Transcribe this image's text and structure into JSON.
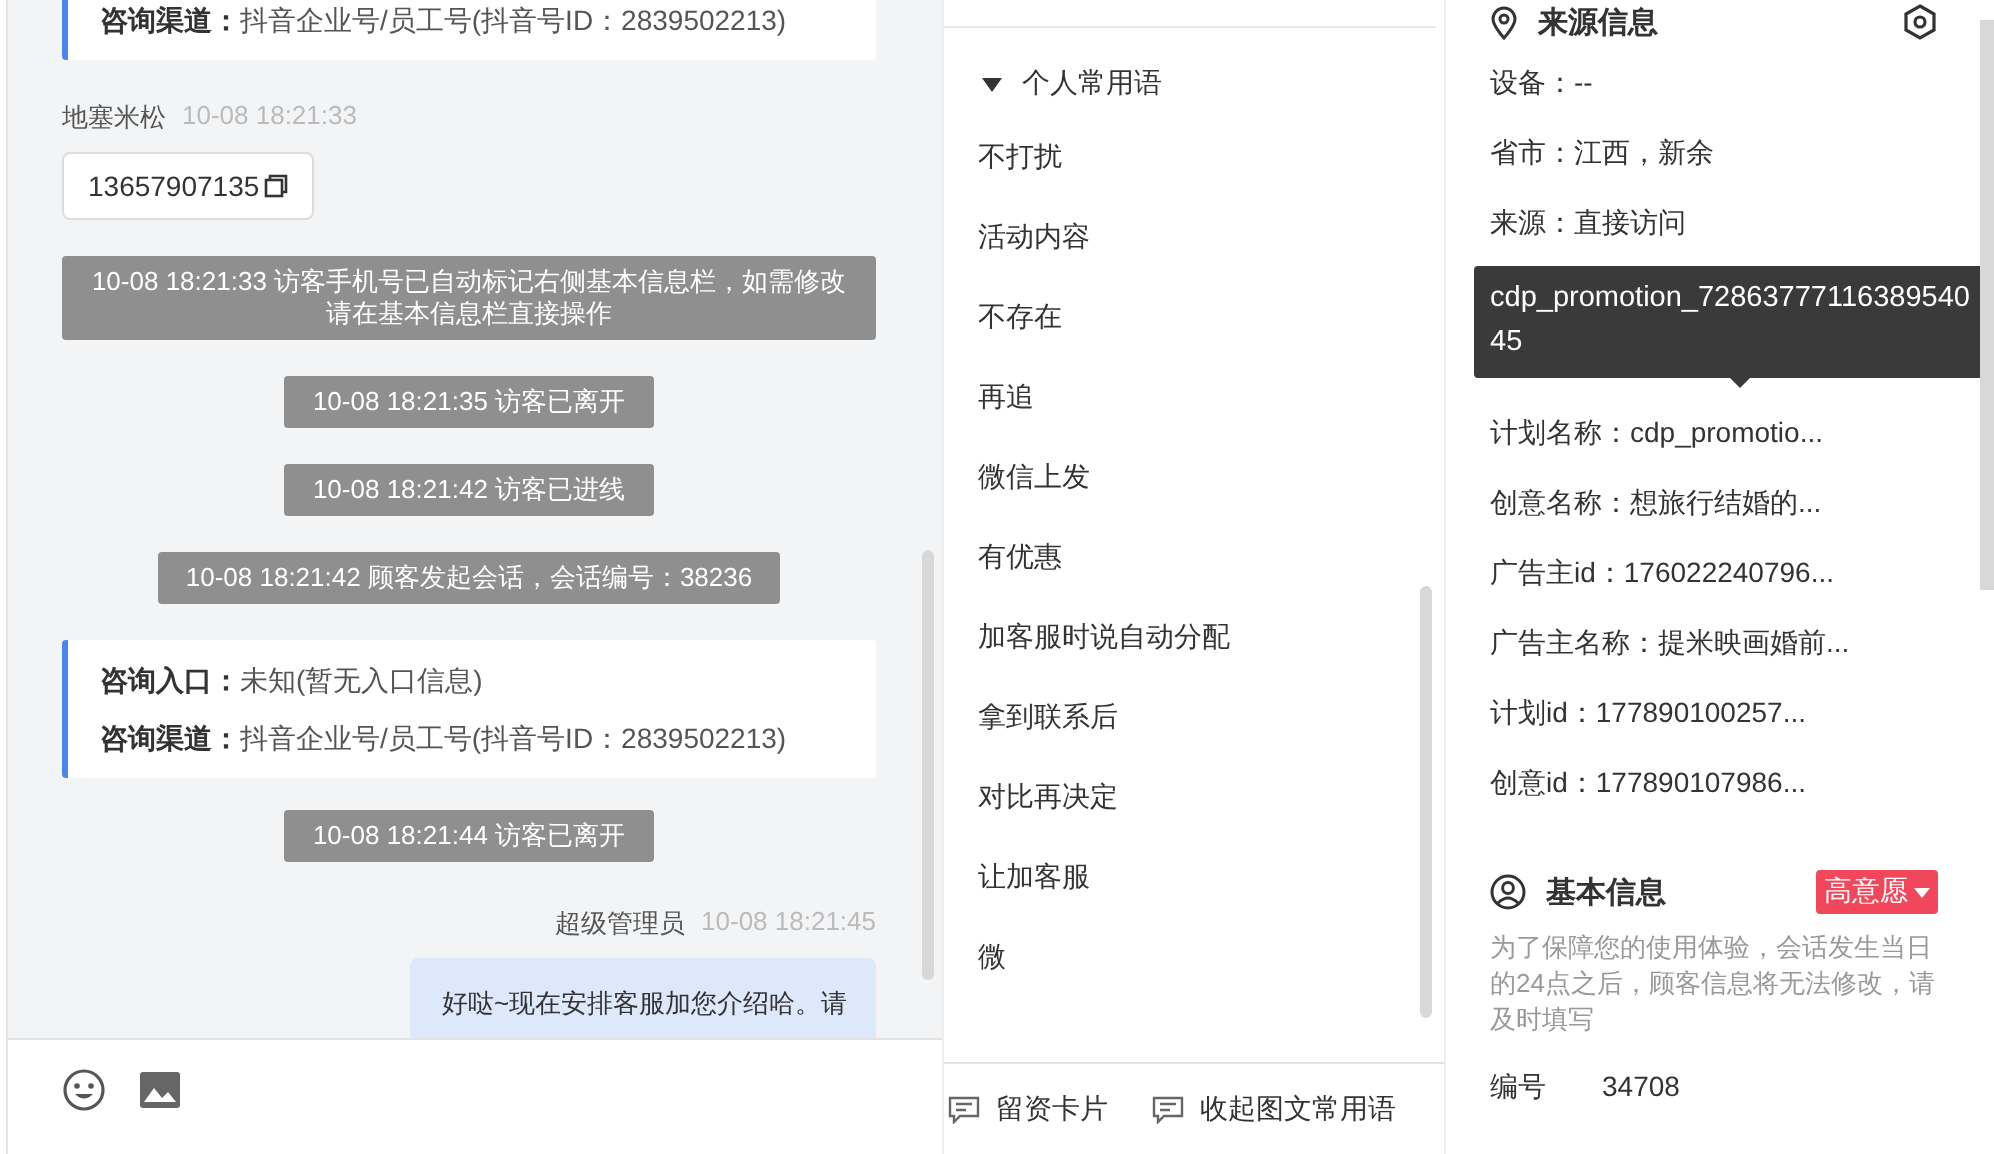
{
  "chat": {
    "messages": [
      {
        "kind": "info_card",
        "rows": [
          {
            "label": "咨询渠道：",
            "value": "抖音企业号/员工号(抖音号ID：2839502213)"
          }
        ]
      },
      {
        "kind": "sender",
        "name": "地塞米松",
        "time": "10-08 18:21:33"
      },
      {
        "kind": "phone",
        "text": "13657907135"
      },
      {
        "kind": "system",
        "text": "10-08 18:21:33 访客手机号已自动标记右侧基本信息栏，如需修改请在基本信息栏直接操作"
      },
      {
        "kind": "system",
        "text": "10-08 18:21:35 访客已离开"
      },
      {
        "kind": "system",
        "text": "10-08 18:21:42 访客已进线"
      },
      {
        "kind": "system",
        "text": "10-08 18:21:42 顾客发起会话，会话编号：38236"
      },
      {
        "kind": "info_card",
        "rows": [
          {
            "label": "咨询入口：",
            "value": "未知(暂无入口信息)"
          },
          {
            "label": "咨询渠道：",
            "value": "抖音企业号/员工号(抖音号ID：2839502213)"
          }
        ]
      },
      {
        "kind": "system",
        "text": "10-08 18:21:44 访客已离开"
      },
      {
        "kind": "agent_header",
        "name": "超级管理员",
        "time": "10-08 18:21:45"
      },
      {
        "kind": "bubble",
        "text": "好哒~现在安排客服加您介绍哈。请"
      }
    ]
  },
  "phrases": {
    "group": {
      "title": "个人常用语",
      "expanded": true
    },
    "items": [
      "不打扰",
      "活动内容",
      "不存在",
      "再追",
      "微信上发",
      "有优惠",
      "加客服时说自动分配",
      "拿到联系后",
      "对比再决定",
      "让加客服",
      "微"
    ],
    "footer": [
      "留资卡片",
      "收起图文常用语"
    ]
  },
  "source_info": {
    "title": "来源信息",
    "rows": [
      {
        "kind": "row",
        "text": "设备：--"
      },
      {
        "kind": "row",
        "text": "省市：江西，新余"
      },
      {
        "kind": "row",
        "text": "来源：直接访问"
      },
      {
        "kind": "tooltip",
        "text": "cdp_promotion_7286377711638954045"
      },
      {
        "kind": "row",
        "text": "计划名称：cdp_promotio..."
      },
      {
        "kind": "row",
        "text": "创意名称：想旅行结婚的..."
      },
      {
        "kind": "row",
        "text": "广告主id：176022240796..."
      },
      {
        "kind": "row",
        "text": "广告主名称：提米映画婚前..."
      },
      {
        "kind": "row",
        "text": "计划id：177890100257..."
      },
      {
        "kind": "row",
        "text": "创意id：177890107986..."
      }
    ]
  },
  "basic_info": {
    "title": "基本信息",
    "tag": "高意愿",
    "notice": "为了保障您的使用体验，会话发生当日的24点之后，顾客信息将无法修改，请及时填写",
    "fields": [
      {
        "label": "编号",
        "value": "34708"
      }
    ]
  }
}
